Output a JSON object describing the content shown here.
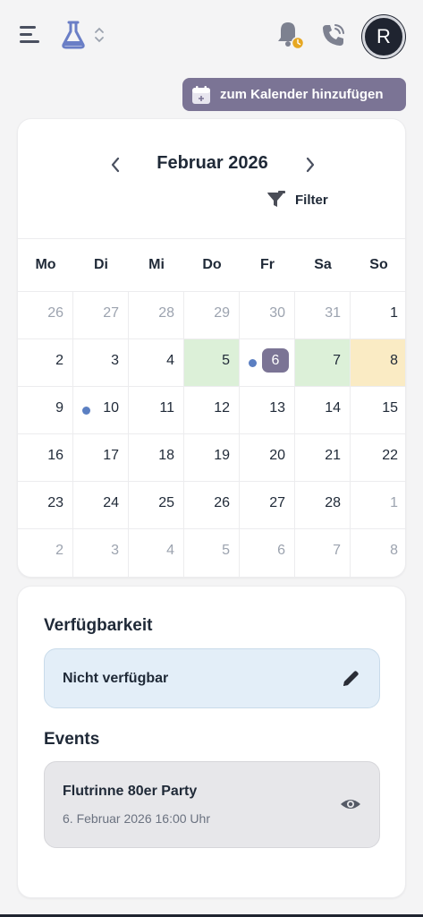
{
  "header": {
    "avatar_initial": "R",
    "add_calendar_label": "zum Kalender hinzufügen",
    "icons": [
      "menu-icon",
      "flask-icon",
      "chevron-updown-icon",
      "bell-clock-icon",
      "phone-icon"
    ]
  },
  "calendar": {
    "month_title": "Februar 2026",
    "filter_label": "Filter",
    "weekdays": [
      "Mo",
      "Di",
      "Mi",
      "Do",
      "Fr",
      "Sa",
      "So"
    ],
    "weeks": [
      [
        {
          "d": "26",
          "m": true
        },
        {
          "d": "27",
          "m": true
        },
        {
          "d": "28",
          "m": true
        },
        {
          "d": "29",
          "m": true
        },
        {
          "d": "30",
          "m": true
        },
        {
          "d": "31",
          "m": true
        },
        {
          "d": "1"
        }
      ],
      [
        {
          "d": "2"
        },
        {
          "d": "3"
        },
        {
          "d": "4"
        },
        {
          "d": "5",
          "hl": "green"
        },
        {
          "d": "6",
          "today": true,
          "dot": true
        },
        {
          "d": "7",
          "hl": "green"
        },
        {
          "d": "8",
          "hl": "yellow"
        }
      ],
      [
        {
          "d": "9"
        },
        {
          "d": "10",
          "dot": true
        },
        {
          "d": "11"
        },
        {
          "d": "12"
        },
        {
          "d": "13"
        },
        {
          "d": "14"
        },
        {
          "d": "15"
        }
      ],
      [
        {
          "d": "16"
        },
        {
          "d": "17"
        },
        {
          "d": "18"
        },
        {
          "d": "19"
        },
        {
          "d": "20"
        },
        {
          "d": "21"
        },
        {
          "d": "22"
        }
      ],
      [
        {
          "d": "23"
        },
        {
          "d": "24"
        },
        {
          "d": "25"
        },
        {
          "d": "26"
        },
        {
          "d": "27"
        },
        {
          "d": "28"
        },
        {
          "d": "1",
          "m": true
        }
      ],
      [
        {
          "d": "2",
          "m": true
        },
        {
          "d": "3",
          "m": true
        },
        {
          "d": "4",
          "m": true
        },
        {
          "d": "5",
          "m": true
        },
        {
          "d": "6",
          "m": true
        },
        {
          "d": "7",
          "m": true
        },
        {
          "d": "8",
          "m": true
        }
      ]
    ],
    "colors": {
      "accent": "#7b7495",
      "green": "#dcf0d8",
      "yellow": "#faebc4",
      "dot": "#5b7fc2"
    }
  },
  "availability": {
    "heading": "Verfügbarkeit",
    "status": "Nicht verfügbar"
  },
  "events": {
    "heading": "Events",
    "items": [
      {
        "title": "Flutrinne 80er Party",
        "date": "6. Februar 2026 16:00 Uhr"
      }
    ]
  }
}
